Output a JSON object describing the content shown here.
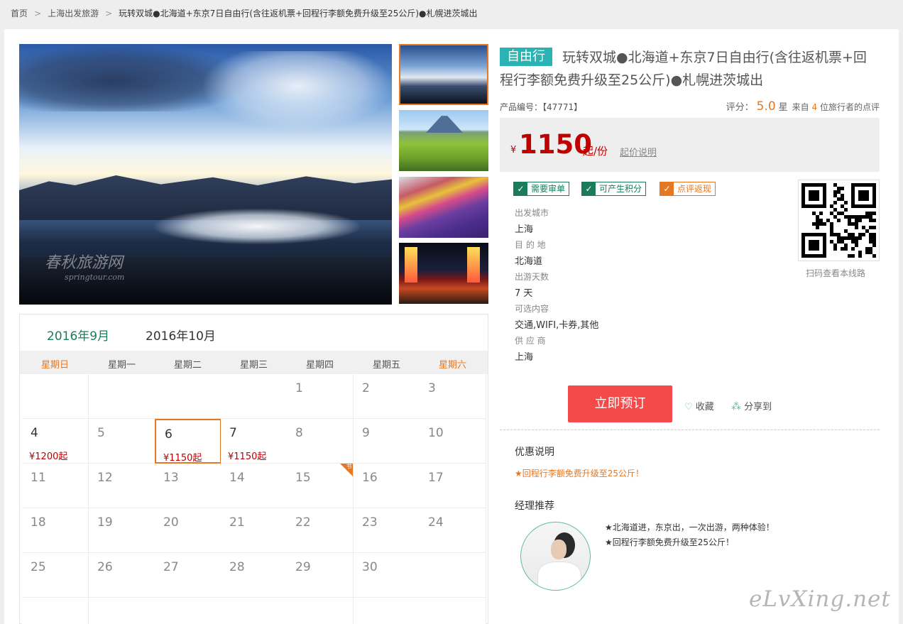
{
  "breadcrumb": [
    "首页",
    "上海出发旅游",
    "玩转双城●北海道+东京7日自由行(含往返机票+回程行李额免费升级至25公斤)●札幌进茨城出"
  ],
  "gallery": {
    "main_watermark": "春秋旅游网",
    "main_watermark_sub": "springtour.com",
    "thumbs": [
      "thumb-1",
      "thumb-2",
      "thumb-3",
      "thumb-4"
    ]
  },
  "calendar": {
    "months": [
      "2016年9月",
      "2016年10月"
    ],
    "weekdays": [
      "星期日",
      "星期一",
      "星期二",
      "星期三",
      "星期四",
      "星期五",
      "星期六"
    ],
    "days": [
      {
        "d": "",
        "p": ""
      },
      {
        "d": "",
        "p": ""
      },
      {
        "d": "",
        "p": ""
      },
      {
        "d": "",
        "p": ""
      },
      {
        "d": "1",
        "p": ""
      },
      {
        "d": "2",
        "p": ""
      },
      {
        "d": "3",
        "p": ""
      },
      {
        "d": "4",
        "p": "¥1200起"
      },
      {
        "d": "5",
        "p": ""
      },
      {
        "d": "6",
        "p": "¥1150起"
      },
      {
        "d": "7",
        "p": "¥1150起"
      },
      {
        "d": "8",
        "p": ""
      },
      {
        "d": "9",
        "p": ""
      },
      {
        "d": "10",
        "p": ""
      },
      {
        "d": "11",
        "p": ""
      },
      {
        "d": "12",
        "p": ""
      },
      {
        "d": "13",
        "p": ""
      },
      {
        "d": "14",
        "p": ""
      },
      {
        "d": "15",
        "p": ""
      },
      {
        "d": "16",
        "p": ""
      },
      {
        "d": "17",
        "p": ""
      },
      {
        "d": "18",
        "p": ""
      },
      {
        "d": "19",
        "p": ""
      },
      {
        "d": "20",
        "p": ""
      },
      {
        "d": "21",
        "p": ""
      },
      {
        "d": "22",
        "p": ""
      },
      {
        "d": "23",
        "p": ""
      },
      {
        "d": "24",
        "p": ""
      },
      {
        "d": "25",
        "p": ""
      },
      {
        "d": "26",
        "p": ""
      },
      {
        "d": "27",
        "p": ""
      },
      {
        "d": "28",
        "p": ""
      },
      {
        "d": "29",
        "p": ""
      },
      {
        "d": "30",
        "p": ""
      },
      {
        "d": "",
        "p": ""
      },
      {
        "d": "",
        "p": ""
      },
      {
        "d": "",
        "p": ""
      },
      {
        "d": "",
        "p": ""
      },
      {
        "d": "",
        "p": ""
      },
      {
        "d": "",
        "p": ""
      },
      {
        "d": "",
        "p": ""
      },
      {
        "d": "",
        "p": ""
      }
    ],
    "holiday_flag": "节"
  },
  "product": {
    "tag": "自由行",
    "title": "玩转双城●北海道+东京7日自由行(含往返机票+回程行李额免费升级至25公斤)●札幌进茨城出",
    "product_no": "产品编号：【47771】",
    "rating_label": "评分：",
    "rating_value": "5.0",
    "rating_unit": "星",
    "reviews_prefix": "来自",
    "reviews_count": "4",
    "reviews_suffix": "位旅行者的点评"
  },
  "price": {
    "currency": "¥",
    "value": "1150",
    "unit": "起/份",
    "explain_link": "起价说明"
  },
  "badges": [
    "需要审单",
    "可产生积分",
    "点评返现"
  ],
  "details": [
    {
      "label": "出发城市",
      "value": "上海"
    },
    {
      "label": "目 的 地",
      "value": "北海道"
    },
    {
      "label": "出游天数",
      "value": "7 天"
    },
    {
      "label": "可选内容",
      "value": "交通,WIFI,卡券,其他"
    },
    {
      "label": "供 应 商",
      "value": "上海"
    }
  ],
  "qr_caption": "扫码查看本线路",
  "actions": {
    "book": "立即预订",
    "favorite": "收藏",
    "share": "分享到"
  },
  "promo": {
    "heading": "优惠说明",
    "text": "★回程行李额免费升级至25公斤！"
  },
  "manager": {
    "heading": "经理推荐",
    "lines": [
      "★北海道进，东京出，一次出游，两种体验！",
      "★回程行李额免费升级至25公斤！"
    ]
  },
  "site_watermark": "eLvXing.net",
  "colors": {
    "accent_orange": "#e87722",
    "brand_green": "#1a7c5a",
    "price_red": "#c00000",
    "book_button": "#f44a4a",
    "tag_teal": "#2bb3b3"
  }
}
